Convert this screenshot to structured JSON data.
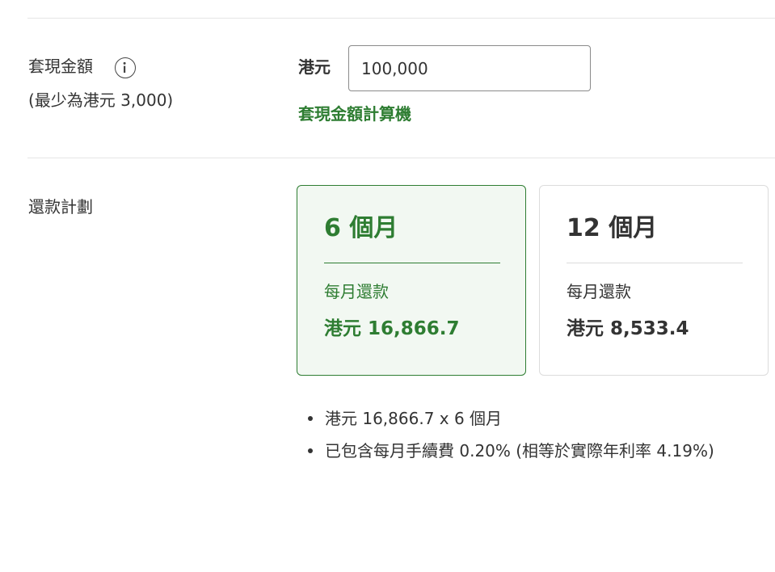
{
  "cash_amount": {
    "label": "套現金額",
    "min_note": "(最少為港元 3,000)",
    "info_icon": "info-icon",
    "currency": "港元",
    "input_value": "100,000",
    "calculator_link": "套現金額計算機"
  },
  "repayment": {
    "label": "還款計劃",
    "plans": [
      {
        "term": "6 個月",
        "monthly_label": "每月還款",
        "monthly_amount": "港元 16,866.7",
        "selected": true
      },
      {
        "term": "12 個月",
        "monthly_label": "每月還款",
        "monthly_amount": "港元 8,533.4",
        "selected": false
      }
    ],
    "notes": [
      "港元 16,866.7 x 6 個月",
      "已包含每月手續費 0.20% (相等於實際年利率 4.19%)"
    ]
  },
  "colors": {
    "accent_green": "#2e7d32",
    "selected_bg": "#f2f8f2",
    "text": "#333333",
    "divider": "#e5e5e5"
  }
}
